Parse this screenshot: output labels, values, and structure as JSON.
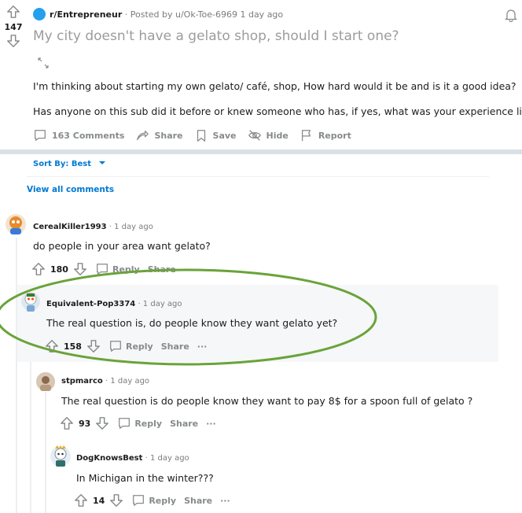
{
  "post": {
    "score": "147",
    "subreddit": "r/Entrepreneur",
    "posted_by": "· Posted by u/Ok-Toe-6969 1 day ago",
    "title": "My city doesn't have a gelato shop, should I start one?",
    "body_line1": "I'm thinking about starting my own gelato/ café, shop, How hard would it be and is it a good idea?",
    "body_line2": "Has anyone on this sub did it before or knew someone who has, if yes, what was your experience like?",
    "actions": {
      "comments": "163 Comments",
      "share": "Share",
      "save": "Save",
      "hide": "Hide",
      "report": "Report"
    }
  },
  "sort": {
    "label": "Sort By: Best"
  },
  "view_all": "View all comments",
  "comments": [
    {
      "author": "CerealKiller1993",
      "time": "· 1 day ago",
      "text": "do people in your area want gelato?",
      "score": "180",
      "reply": "Reply",
      "share": "Share",
      "more": "···"
    },
    {
      "author": "Equivalent-Pop3374",
      "time": "· 1 day ago",
      "text": "The real question is, do people know they want gelato yet?",
      "score": "158",
      "reply": "Reply",
      "share": "Share",
      "more": "···"
    },
    {
      "author": "stpmarco",
      "time": "· 1 day ago",
      "text": "The real question is do people know they want to pay 8$ for a spoon full of gelato ?",
      "score": "93",
      "reply": "Reply",
      "share": "Share",
      "more": "···"
    },
    {
      "author": "DogKnowsBest",
      "time": "· 1 day ago",
      "text": "In Michigan in the winter???",
      "score": "14",
      "reply": "Reply",
      "share": "Share",
      "more": "···"
    }
  ],
  "colors": {
    "accent": "#0079d3",
    "annotation_ellipse": "#6aa33a",
    "divider": "#dae0e6"
  },
  "icons": [
    "upvote-icon",
    "downvote-icon",
    "subreddit-icon",
    "expand-icon",
    "comment-icon",
    "share-icon",
    "save-icon",
    "hide-icon",
    "report-icon",
    "bell-icon",
    "chevron-down-icon"
  ]
}
